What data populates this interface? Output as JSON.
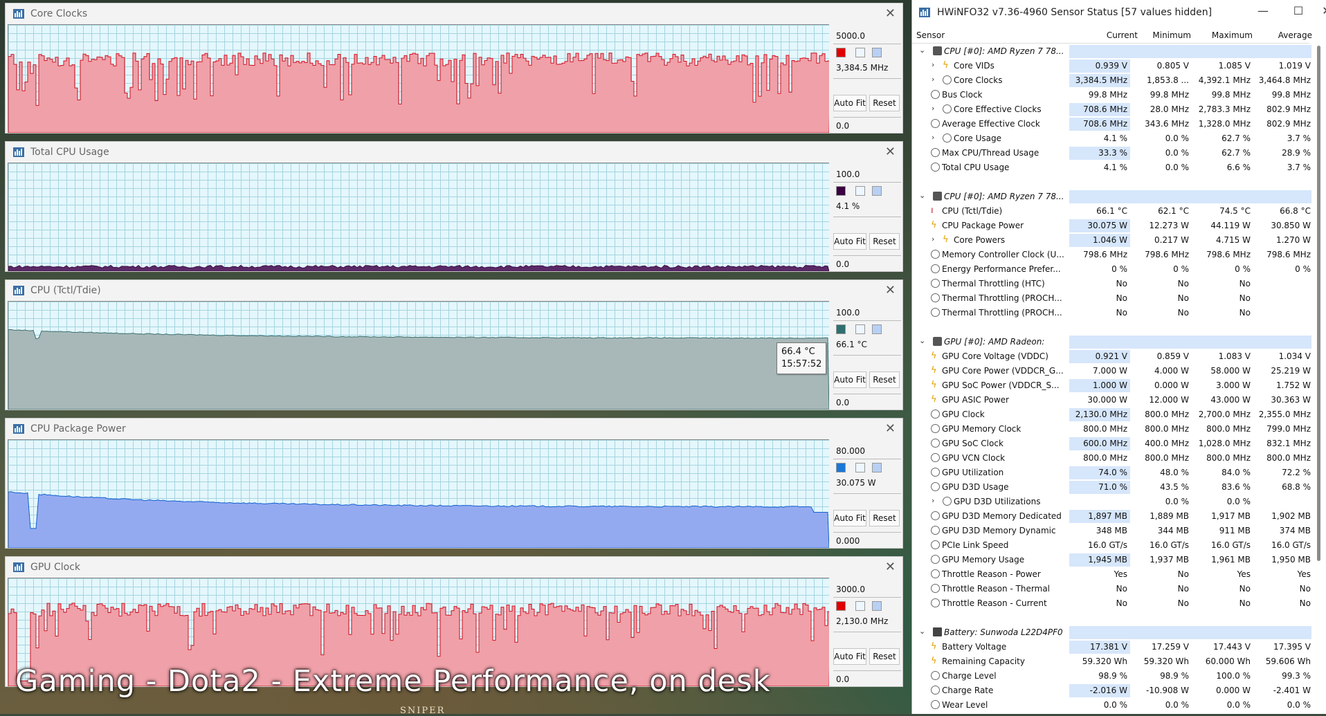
{
  "overlay_text": "Gaming - Dota2 - Extreme Performance, on desk",
  "background_text": "SNIPER",
  "graphs": [
    {
      "title": "Core Clocks",
      "max": "5000.0",
      "current": "3,384.5 MHz",
      "min": "0.0",
      "auto_fit": "Auto Fit",
      "reset": "Reset",
      "color": "#f0a0a8",
      "line": "#d01020",
      "swatch": "#e00000",
      "level": 0.68
    },
    {
      "title": "Total CPU Usage",
      "max": "100.0",
      "current": "4.1 %",
      "min": "0.0",
      "auto_fit": "Auto Fit",
      "reset": "Reset",
      "color": "#5a2a66",
      "line": "#3a0a46",
      "swatch": "#3a0040",
      "level": 0.04
    },
    {
      "title": "CPU (Tctl/Tdie)",
      "max": "100.0",
      "current": "66.1 °C",
      "min": "0.0",
      "auto_fit": "Auto Fit",
      "reset": "Reset",
      "color": "#a8b8b8",
      "line": "#3a7070",
      "swatch": "#2e7070",
      "level": 0.66,
      "tooltip": {
        "value": "66.4 °C",
        "time": "15:57:52"
      }
    },
    {
      "title": "CPU Package Power",
      "max": "80.000",
      "current": "30.075 W",
      "min": "0.000",
      "auto_fit": "Auto Fit",
      "reset": "Reset",
      "color": "#94aaf0",
      "line": "#1060d0",
      "swatch": "#1a78d8",
      "level": 0.38
    },
    {
      "title": "GPU Clock",
      "max": "3000.0",
      "current": "2,130.0 MHz",
      "min": "0.0",
      "auto_fit": "Auto Fit",
      "reset": "Reset",
      "color": "#f0a0a8",
      "line": "#d01020",
      "swatch": "#e00000",
      "level": 0.71
    }
  ],
  "hw": {
    "title": "HWiNFO32 v7.36-4960 Sensor Status [57 values hidden]",
    "minimize": "—",
    "maximize": "☐",
    "close": "✕",
    "cols": {
      "sensor": "Sensor",
      "current": "Current",
      "minimum": "Minimum",
      "maximum": "Maximum",
      "average": "Average"
    },
    "rows": [
      {
        "t": "grp",
        "icon": "chip",
        "name": "CPU [#0]: AMD Ryzen 7 78...",
        "exp": "⌄"
      },
      {
        "t": "r",
        "icon": "bolt",
        "exp": "›",
        "ind": 1,
        "name": "Core VIDs",
        "c": "0.939 V",
        "mn": "0.805 V",
        "mx": "1.085 V",
        "av": "1.019 V",
        "hl": true
      },
      {
        "t": "r",
        "icon": "clock",
        "exp": "›",
        "ind": 1,
        "name": "Core Clocks",
        "c": "3,384.5 MHz",
        "mn": "1,853.8 ...",
        "mx": "4,392.1 MHz",
        "av": "3,464.8 MHz",
        "hl": true
      },
      {
        "t": "r",
        "icon": "clock",
        "name": "Bus Clock",
        "c": "99.8 MHz",
        "mn": "99.8 MHz",
        "mx": "99.8 MHz",
        "av": "99.8 MHz"
      },
      {
        "t": "r",
        "icon": "clock",
        "exp": "›",
        "ind": 1,
        "name": "Core Effective Clocks",
        "c": "708.6 MHz",
        "mn": "28.0 MHz",
        "mx": "2,783.3 MHz",
        "av": "802.9 MHz",
        "hl": true
      },
      {
        "t": "r",
        "icon": "clock",
        "name": "Average Effective Clock",
        "c": "708.6 MHz",
        "mn": "343.6 MHz",
        "mx": "1,328.0 MHz",
        "av": "802.9 MHz",
        "hl": true
      },
      {
        "t": "r",
        "icon": "clock",
        "exp": "›",
        "ind": 1,
        "name": "Core Usage",
        "c": "4.1 %",
        "mn": "0.0 %",
        "mx": "62.7 %",
        "av": "3.7 %"
      },
      {
        "t": "r",
        "icon": "clock",
        "name": "Max CPU/Thread Usage",
        "c": "33.3 %",
        "mn": "0.0 %",
        "mx": "62.7 %",
        "av": "28.9 %",
        "hl": true
      },
      {
        "t": "r",
        "icon": "clock",
        "name": "Total CPU Usage",
        "c": "4.1 %",
        "mn": "0.0 %",
        "mx": "6.6 %",
        "av": "3.7 %"
      },
      {
        "t": "blank"
      },
      {
        "t": "grp",
        "icon": "chip",
        "name": "CPU [#0]: AMD Ryzen 7 78...",
        "exp": "⌄"
      },
      {
        "t": "r",
        "icon": "therm",
        "name": "CPU (Tctl/Tdie)",
        "c": "66.1 °C",
        "mn": "62.1 °C",
        "mx": "74.5 °C",
        "av": "66.8 °C"
      },
      {
        "t": "r",
        "icon": "bolt",
        "name": "CPU Package Power",
        "c": "30.075 W",
        "mn": "12.273 W",
        "mx": "44.119 W",
        "av": "30.850 W",
        "hl": true
      },
      {
        "t": "r",
        "icon": "bolt",
        "exp": "›",
        "ind": 1,
        "name": "Core Powers",
        "c": "1.046 W",
        "mn": "0.217 W",
        "mx": "4.715 W",
        "av": "1.270 W",
        "hl": true
      },
      {
        "t": "r",
        "icon": "clock",
        "name": "Memory Controller Clock (U...",
        "c": "798.6 MHz",
        "mn": "798.6 MHz",
        "mx": "798.6 MHz",
        "av": "798.6 MHz"
      },
      {
        "t": "r",
        "icon": "clock",
        "name": "Energy Performance Prefer...",
        "c": "0 %",
        "mn": "0 %",
        "mx": "0 %",
        "av": "0 %"
      },
      {
        "t": "r",
        "icon": "clock",
        "name": "Thermal Throttling (HTC)",
        "c": "No",
        "mn": "No",
        "mx": "No",
        "av": ""
      },
      {
        "t": "r",
        "icon": "clock",
        "name": "Thermal Throttling (PROCH...",
        "c": "No",
        "mn": "No",
        "mx": "No",
        "av": ""
      },
      {
        "t": "r",
        "icon": "clock",
        "name": "Thermal Throttling (PROCH...",
        "c": "No",
        "mn": "No",
        "mx": "No",
        "av": ""
      },
      {
        "t": "blank"
      },
      {
        "t": "grp",
        "icon": "chip",
        "name": "GPU [#0]: AMD Radeon:",
        "exp": "⌄"
      },
      {
        "t": "r",
        "icon": "bolt",
        "name": "GPU Core Voltage (VDDC)",
        "c": "0.921 V",
        "mn": "0.859 V",
        "mx": "1.083 V",
        "av": "1.034 V",
        "hl": true
      },
      {
        "t": "r",
        "icon": "bolt",
        "name": "GPU Core Power (VDDCR_G...",
        "c": "7.000 W",
        "mn": "4.000 W",
        "mx": "58.000 W",
        "av": "25.219 W"
      },
      {
        "t": "r",
        "icon": "bolt",
        "name": "GPU SoC Power (VDDCR_S...",
        "c": "1.000 W",
        "mn": "0.000 W",
        "mx": "3.000 W",
        "av": "1.752 W",
        "hl": true
      },
      {
        "t": "r",
        "icon": "bolt",
        "name": "GPU ASIC Power",
        "c": "30.000 W",
        "mn": "12.000 W",
        "mx": "43.000 W",
        "av": "30.363 W"
      },
      {
        "t": "r",
        "icon": "clock",
        "name": "GPU Clock",
        "c": "2,130.0 MHz",
        "mn": "800.0 MHz",
        "mx": "2,700.0 MHz",
        "av": "2,355.0 MHz",
        "hl": true
      },
      {
        "t": "r",
        "icon": "clock",
        "name": "GPU Memory Clock",
        "c": "800.0 MHz",
        "mn": "800.0 MHz",
        "mx": "800.0 MHz",
        "av": "799.0 MHz"
      },
      {
        "t": "r",
        "icon": "clock",
        "name": "GPU SoC Clock",
        "c": "600.0 MHz",
        "mn": "400.0 MHz",
        "mx": "1,028.0 MHz",
        "av": "832.1 MHz",
        "hl": true
      },
      {
        "t": "r",
        "icon": "clock",
        "name": "GPU VCN Clock",
        "c": "800.0 MHz",
        "mn": "800.0 MHz",
        "mx": "800.0 MHz",
        "av": "800.0 MHz"
      },
      {
        "t": "r",
        "icon": "clock",
        "name": "GPU Utilization",
        "c": "74.0 %",
        "mn": "48.0 %",
        "mx": "84.0 %",
        "av": "72.2 %",
        "hl": true
      },
      {
        "t": "r",
        "icon": "clock",
        "name": "GPU D3D Usage",
        "c": "71.0 %",
        "mn": "43.5 %",
        "mx": "83.6 %",
        "av": "68.8 %",
        "hl": true
      },
      {
        "t": "r",
        "icon": "clock",
        "exp": "›",
        "ind": 1,
        "name": "GPU D3D Utilizations",
        "c": "",
        "mn": "0.0 %",
        "mx": "0.0 %",
        "av": ""
      },
      {
        "t": "r",
        "icon": "clock",
        "name": "GPU D3D Memory Dedicated",
        "c": "1,897 MB",
        "mn": "1,889 MB",
        "mx": "1,917 MB",
        "av": "1,902 MB",
        "hl": true
      },
      {
        "t": "r",
        "icon": "clock",
        "name": "GPU D3D Memory Dynamic",
        "c": "348 MB",
        "mn": "344 MB",
        "mx": "911 MB",
        "av": "374 MB"
      },
      {
        "t": "r",
        "icon": "clock",
        "name": "PCIe Link Speed",
        "c": "16.0 GT/s",
        "mn": "16.0 GT/s",
        "mx": "16.0 GT/s",
        "av": "16.0 GT/s"
      },
      {
        "t": "r",
        "icon": "clock",
        "name": "GPU Memory Usage",
        "c": "1,945 MB",
        "mn": "1,937 MB",
        "mx": "1,961 MB",
        "av": "1,950 MB",
        "hl": true
      },
      {
        "t": "r",
        "icon": "clock",
        "name": "Throttle Reason - Power",
        "c": "Yes",
        "mn": "No",
        "mx": "Yes",
        "av": "Yes"
      },
      {
        "t": "r",
        "icon": "clock",
        "name": "Throttle Reason - Thermal",
        "c": "No",
        "mn": "No",
        "mx": "No",
        "av": "No"
      },
      {
        "t": "r",
        "icon": "clock",
        "name": "Throttle Reason - Current",
        "c": "No",
        "mn": "No",
        "mx": "No",
        "av": "No"
      },
      {
        "t": "blank"
      },
      {
        "t": "grp",
        "icon": "batt",
        "name": "Battery: Sunwoda L22D4PF0",
        "exp": "⌄"
      },
      {
        "t": "r",
        "icon": "bolt",
        "name": "Battery Voltage",
        "c": "17.381 V",
        "mn": "17.259 V",
        "mx": "17.443 V",
        "av": "17.395 V",
        "hl": true
      },
      {
        "t": "r",
        "icon": "bolt",
        "name": "Remaining Capacity",
        "c": "59.320 Wh",
        "mn": "59.320 Wh",
        "mx": "60.000 Wh",
        "av": "59.606 Wh"
      },
      {
        "t": "r",
        "icon": "clock",
        "name": "Charge Level",
        "c": "98.9 %",
        "mn": "98.9 %",
        "mx": "100.0 %",
        "av": "99.3 %"
      },
      {
        "t": "r",
        "icon": "clock",
        "name": "Charge Rate",
        "c": "-2.016 W",
        "mn": "-10.908 W",
        "mx": "0.000 W",
        "av": "-2.401 W",
        "hl": true
      },
      {
        "t": "r",
        "icon": "clock",
        "name": "Wear Level",
        "c": "0.0 %",
        "mn": "0.0 %",
        "mx": "0.0 %",
        "av": "0.0 %"
      }
    ]
  }
}
